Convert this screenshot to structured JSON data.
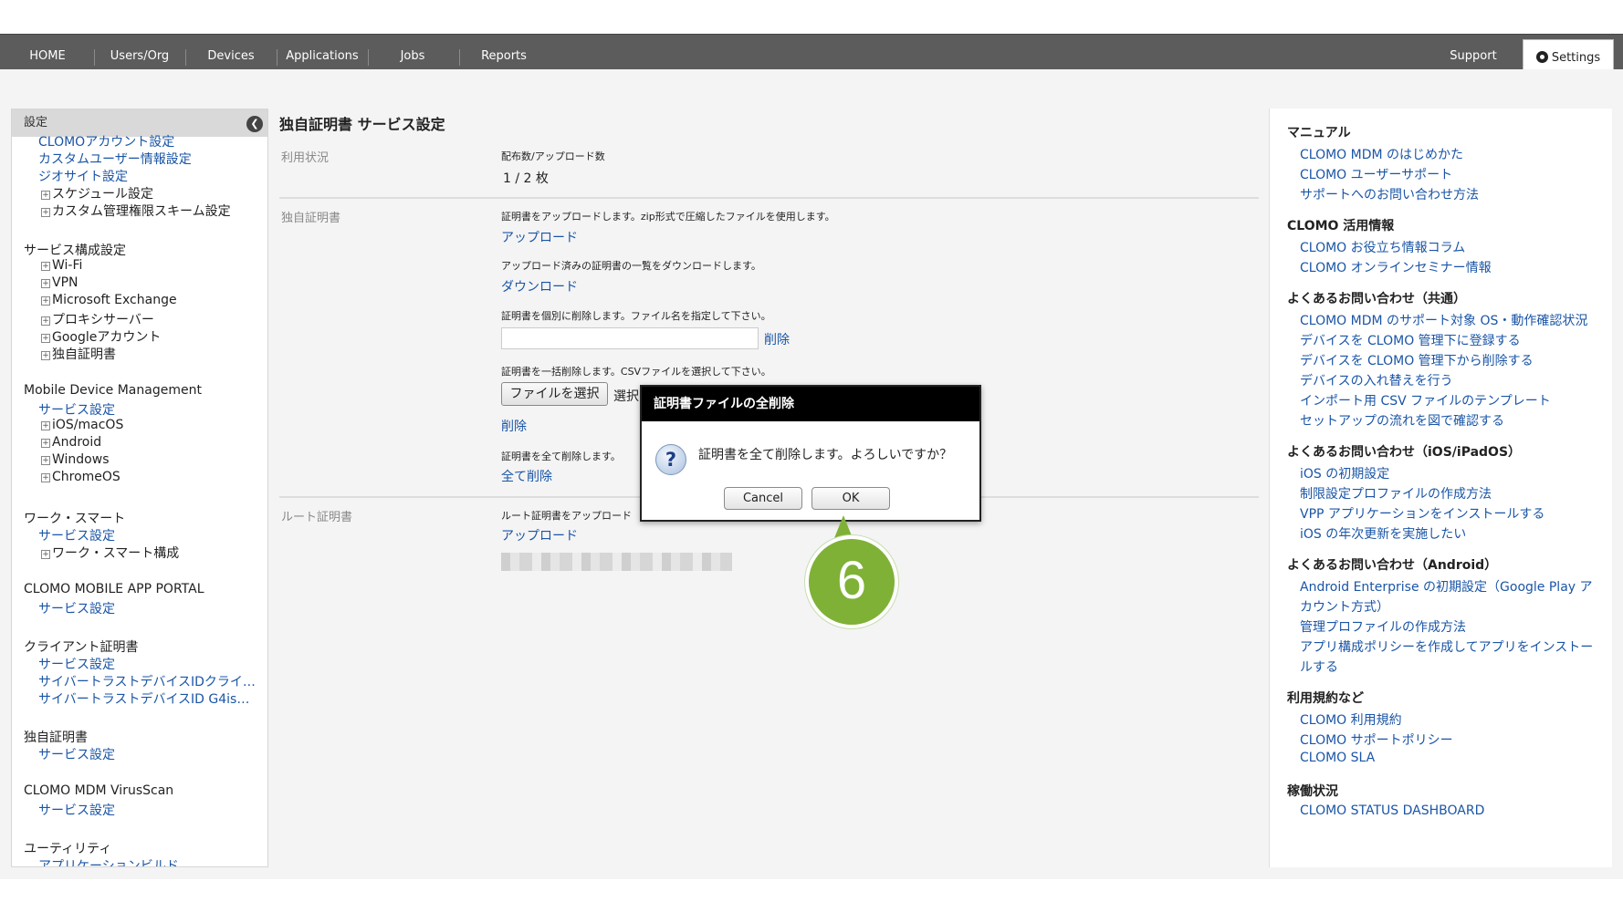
{
  "nav": {
    "items": [
      "HOME",
      "Users/Org",
      "Devices",
      "Applications",
      "Jobs",
      "Reports"
    ],
    "support": "Support",
    "settings": "Settings"
  },
  "sidebar": {
    "title": "設定",
    "collapse_icon": "chevron-left-icon",
    "lines": [
      {
        "type": "link",
        "text": "CLOMOアカウント設定"
      },
      {
        "type": "link",
        "text": "カスタムユーザー情報設定"
      },
      {
        "type": "link",
        "text": "ジオサイト設定"
      },
      {
        "type": "expand",
        "text": "スケジュール設定"
      },
      {
        "type": "expand",
        "text": "カスタム管理権限スキーム設定"
      },
      {
        "type": "section",
        "text": "サービス構成設定"
      },
      {
        "type": "expand",
        "text": "Wi-Fi"
      },
      {
        "type": "expand",
        "text": "VPN"
      },
      {
        "type": "expand",
        "text": "Microsoft Exchange"
      },
      {
        "type": "expand",
        "text": "プロキシサーバー"
      },
      {
        "type": "expand",
        "text": "Googleアカウント"
      },
      {
        "type": "expand",
        "text": "独自証明書"
      },
      {
        "type": "section",
        "text": "Mobile Device Management"
      },
      {
        "type": "link",
        "text": "サービス設定"
      },
      {
        "type": "expand",
        "text": "iOS/macOS"
      },
      {
        "type": "expand",
        "text": "Android"
      },
      {
        "type": "expand",
        "text": "Windows"
      },
      {
        "type": "expand",
        "text": "ChromeOS"
      },
      {
        "type": "section",
        "text": "ワーク・スマート"
      },
      {
        "type": "link",
        "text": "サービス設定"
      },
      {
        "type": "expand",
        "text": "ワーク・スマート構成"
      },
      {
        "type": "section",
        "text": "CLOMO MOBILE APP PORTAL"
      },
      {
        "type": "link",
        "text": "サービス設定"
      },
      {
        "type": "section",
        "text": "クライアント証明書"
      },
      {
        "type": "link",
        "text": "サービス設定"
      },
      {
        "type": "link",
        "text": "サイバートラストデバイスIDクライ…"
      },
      {
        "type": "link",
        "text": "サイバートラストデバイスID G4is…"
      },
      {
        "type": "section",
        "text": "独自証明書"
      },
      {
        "type": "link",
        "text": "サービス設定"
      },
      {
        "type": "section",
        "text": "CLOMO MDM VirusScan"
      },
      {
        "type": "link",
        "text": "サービス設定"
      },
      {
        "type": "section",
        "text": "ユーティリティ"
      },
      {
        "type": "link",
        "text": "アプリケーションビルド"
      }
    ]
  },
  "main": {
    "title": "独自証明書 サービス設定",
    "usage": {
      "label": "利用状況",
      "desc": "配布数/アップロード数",
      "value": "1 / 2 枚"
    },
    "cert": {
      "label": "独自証明書",
      "upload_desc": "証明書をアップロードします。zip形式で圧縮したファイルを使用します。",
      "upload_link": "アップロード",
      "download_desc": "アップロード済みの証明書の一覧をダウンロードします。",
      "download_link": "ダウンロード",
      "delete_one_desc": "証明書を個別に削除します。ファイル名を指定して下さい。",
      "delete_one_link": "削除",
      "delete_bulk_desc": "証明書を一括削除します。CSVファイルを選択して下さい。",
      "file_button": "ファイルを選択",
      "file_status": "選択",
      "delete_bulk_link": "削除",
      "delete_all_desc": "証明書を全て削除します。",
      "delete_all_link": "全て削除"
    },
    "root": {
      "label": "ルート証明書",
      "desc": "ルート証明書をアップロード",
      "upload_link": "アップロード"
    }
  },
  "dialog": {
    "title": "証明書ファイルの全削除",
    "icon": "question-icon",
    "message": "証明書を全て削除します。よろしいですか？",
    "cancel": "Cancel",
    "ok": "OK"
  },
  "callout": {
    "number": "6",
    "color": "#7fb136"
  },
  "right_panel": {
    "sections": [
      {
        "heading": "マニュアル",
        "links": [
          "CLOMO MDM のはじめかた",
          "CLOMO ユーザーサポート",
          "サポートへのお問い合わせ方法"
        ]
      },
      {
        "heading": "CLOMO 活用情報",
        "links": [
          "CLOMO お役立ち情報コラム",
          "CLOMO オンラインセミナー情報"
        ]
      },
      {
        "heading": "よくあるお問い合わせ（共通）",
        "links": [
          "CLOMO MDM のサポート対象 OS・動作確認状況",
          "デバイスを CLOMO 管理下に登録する",
          "デバイスを CLOMO 管理下から削除する",
          "デバイスの入れ替えを行う",
          "インポート用 CSV ファイルのテンプレート",
          "セットアップの流れを図で確認する"
        ]
      },
      {
        "heading": "よくあるお問い合わせ（iOS/iPadOS）",
        "links": [
          "iOS の初期設定",
          "制限設定プロファイルの作成方法",
          "VPP アプリケーションをインストールする",
          "iOS の年次更新を実施したい"
        ]
      },
      {
        "heading": "よくあるお問い合わせ（Android）",
        "links": [
          "Android Enterprise の初期設定（Google Play ア",
          "カウント方式）",
          "管理プロファイルの作成方法",
          "アプリ構成ポリシーを作成してアプリをインストー",
          "ルする"
        ]
      },
      {
        "heading": "利用規約など",
        "links": [
          "CLOMO 利用規約",
          "CLOMO サポートポリシー",
          "CLOMO SLA"
        ]
      },
      {
        "heading": "稼働状況",
        "links": [
          "CLOMO STATUS DASHBOARD"
        ]
      }
    ]
  }
}
